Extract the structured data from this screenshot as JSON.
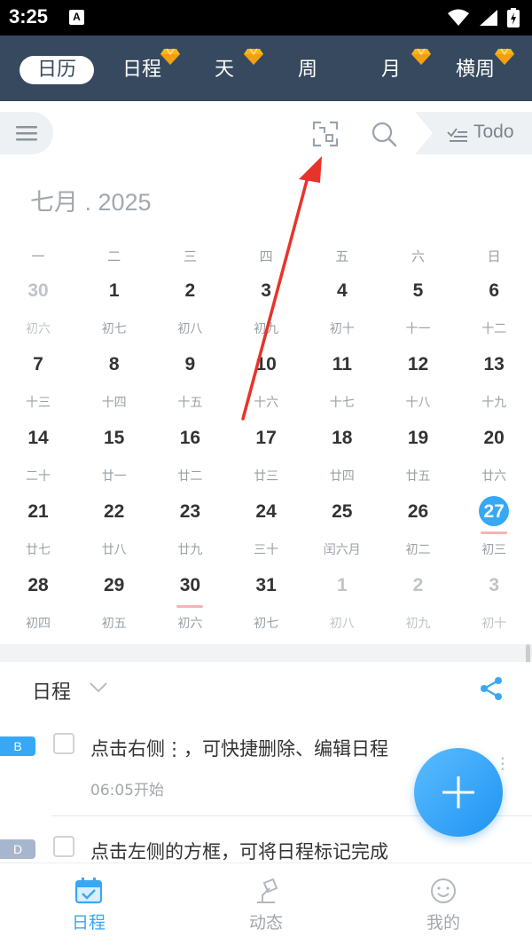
{
  "status_bar": {
    "time": "3:25",
    "notification_icon": "A"
  },
  "top_nav": {
    "tabs": [
      {
        "label": "日历",
        "active": true,
        "premium": false
      },
      {
        "label": "日程",
        "active": false,
        "premium": true
      },
      {
        "label": "天",
        "active": false,
        "premium": true
      },
      {
        "label": "周",
        "active": false,
        "premium": false
      },
      {
        "label": "月",
        "active": false,
        "premium": true
      },
      {
        "label": "横周",
        "active": false,
        "premium": true
      }
    ],
    "background": "#36495e"
  },
  "toolbar": {
    "todo_label": "Todo",
    "icons": [
      "menu-icon",
      "scan-icon",
      "search-icon",
      "todo-icon"
    ]
  },
  "calendar": {
    "title": "七月 . 2025",
    "weekdays": [
      "一",
      "二",
      "三",
      "四",
      "五",
      "六",
      "日"
    ],
    "weeks": [
      [
        {
          "d": "30",
          "l": "初六",
          "other": true
        },
        {
          "d": "1",
          "l": "初七"
        },
        {
          "d": "2",
          "l": "初八"
        },
        {
          "d": "3",
          "l": "初九"
        },
        {
          "d": "4",
          "l": "初十"
        },
        {
          "d": "5",
          "l": "十一"
        },
        {
          "d": "6",
          "l": "十二"
        }
      ],
      [
        {
          "d": "7",
          "l": "十三"
        },
        {
          "d": "8",
          "l": "十四"
        },
        {
          "d": "9",
          "l": "十五"
        },
        {
          "d": "10",
          "l": "十六"
        },
        {
          "d": "11",
          "l": "十七"
        },
        {
          "d": "12",
          "l": "十八"
        },
        {
          "d": "13",
          "l": "十九"
        }
      ],
      [
        {
          "d": "14",
          "l": "二十"
        },
        {
          "d": "15",
          "l": "廿一"
        },
        {
          "d": "16",
          "l": "廿二"
        },
        {
          "d": "17",
          "l": "廿三"
        },
        {
          "d": "18",
          "l": "廿四"
        },
        {
          "d": "19",
          "l": "廿五"
        },
        {
          "d": "20",
          "l": "廿六"
        }
      ],
      [
        {
          "d": "21",
          "l": "廿七"
        },
        {
          "d": "22",
          "l": "廿八"
        },
        {
          "d": "23",
          "l": "廿九"
        },
        {
          "d": "24",
          "l": "三十"
        },
        {
          "d": "25",
          "l": "闰六月"
        },
        {
          "d": "26",
          "l": "初二"
        },
        {
          "d": "27",
          "l": "初三",
          "today": true,
          "marked": true
        }
      ],
      [
        {
          "d": "28",
          "l": "初四"
        },
        {
          "d": "29",
          "l": "初五"
        },
        {
          "d": "30",
          "l": "初六",
          "marked": true
        },
        {
          "d": "31",
          "l": "初七"
        },
        {
          "d": "1",
          "l": "初八",
          "other": true
        },
        {
          "d": "2",
          "l": "初九",
          "other": true
        },
        {
          "d": "3",
          "l": "初十",
          "other": true
        }
      ]
    ],
    "today_color": "#36a8f5"
  },
  "schedule": {
    "title": "日程",
    "events": [
      {
        "tag": "B",
        "tag_color": "#36a8f5",
        "text": "点击右侧⋮，可快捷删除、编辑日程",
        "sub": "06:05开始"
      },
      {
        "tag": "D",
        "tag_color": "#a7b6cc",
        "text": "点击左侧的方框，可将日程标记完成",
        "sub": ""
      }
    ]
  },
  "bottom_nav": [
    {
      "label": "日程",
      "icon": "calendar-icon",
      "active": true
    },
    {
      "label": "动态",
      "icon": "lamp-icon",
      "active": false
    },
    {
      "label": "我的",
      "icon": "smiley-icon",
      "active": false
    }
  ],
  "accent_color": "#36a8f5",
  "annotation_color": "#e8332b"
}
